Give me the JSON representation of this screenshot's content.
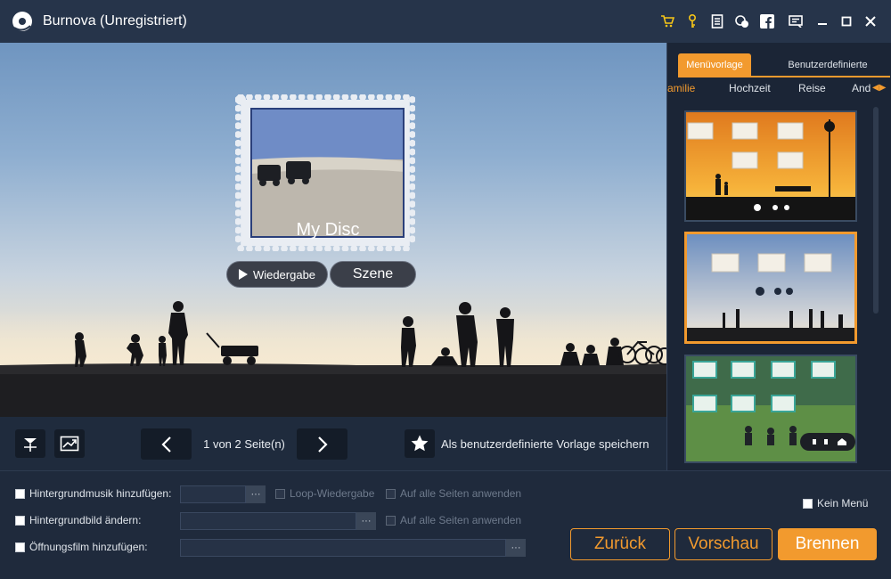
{
  "window": {
    "title": "Burnova (Unregistriert)"
  },
  "titlebar_icons": [
    "cart-icon",
    "key-icon",
    "document-icon",
    "support-icon",
    "facebook-icon",
    "feedback-icon",
    "minimize-icon",
    "maximize-icon",
    "close-icon"
  ],
  "preview": {
    "disc_title": "My Disc",
    "play_label": "Wiedergabe",
    "scene_label": "Szene"
  },
  "preview_bar": {
    "page_info": "1 von 2 Seite(n)",
    "save_template_label": "Als benutzerdefinierte Vorlage speichern"
  },
  "panel": {
    "tabs": [
      {
        "label": "Menüvorlage",
        "active": true
      },
      {
        "label": "Benutzerdefinierte",
        "active": false
      }
    ],
    "categories": [
      {
        "label": "amilie",
        "active": true
      },
      {
        "label": "Hochzeit",
        "active": false
      },
      {
        "label": "Reise",
        "active": false
      },
      {
        "label": "And",
        "active": false
      }
    ],
    "templates": [
      {
        "theme": "sunset-family",
        "selected": false
      },
      {
        "theme": "blue-silhouettes",
        "selected": true
      },
      {
        "theme": "park-green",
        "selected": false
      }
    ]
  },
  "settings": {
    "bg_music_label": "Hintergrundmusik hinzufügen:",
    "loop_label": "Loop-Wiedergabe",
    "apply_all_music_label": "Auf alle Seiten anwenden",
    "bg_image_label": "Hintergrundbild ändern:",
    "apply_all_image_label": "Auf alle Seiten anwenden",
    "opening_film_label": "Öffnungsfilm hinzufügen:",
    "browse_label": "···",
    "no_menu_label": "Kein Menü"
  },
  "actions": {
    "back_label": "Zurück",
    "preview_label": "Vorschau",
    "burn_label": "Brennen"
  },
  "colors": {
    "accent": "#f29a2e",
    "titlebar": "#26344a",
    "background": "#1f2a3c"
  }
}
